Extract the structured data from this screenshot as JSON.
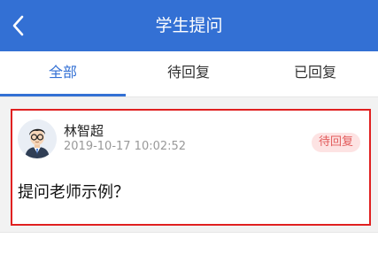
{
  "header": {
    "title": "学生提问",
    "back_icon": "chevron-left-icon",
    "background": "#3370d4"
  },
  "tabs": [
    {
      "label": "全部",
      "active": true
    },
    {
      "label": "待回复",
      "active": false
    },
    {
      "label": "已回复",
      "active": false
    }
  ],
  "questions": [
    {
      "user_name": "林智超",
      "timestamp": "2019-10-17 10:02:52",
      "status": "待回复",
      "text": "提问老师示例？",
      "avatar_icon": "user-avatar-icon"
    }
  ],
  "colors": {
    "accent": "#3370d4",
    "highlight_border": "#e02020",
    "status_bg": "#fde3e3",
    "status_text": "#e25b5b"
  }
}
